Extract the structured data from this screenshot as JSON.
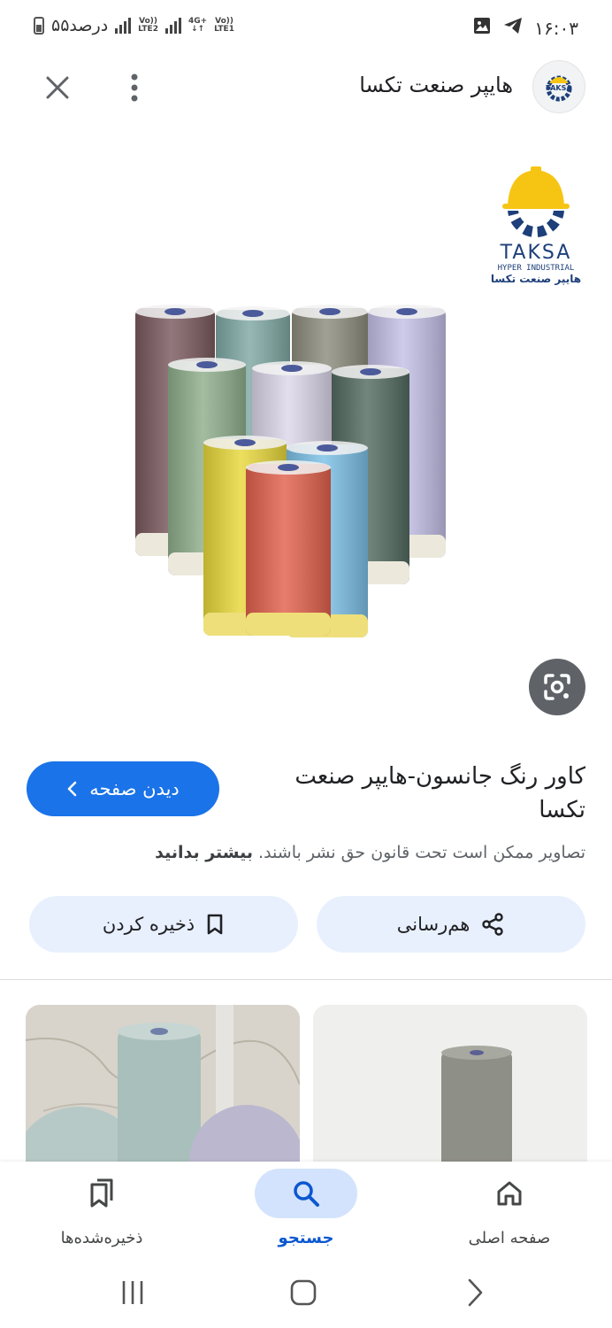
{
  "status_bar": {
    "battery_text": "۵۵درصد",
    "net1": [
      "Vo))",
      "LTE2"
    ],
    "net2": [
      "4G+",
      "↓↑"
    ],
    "net3": [
      "Vo))",
      "LTE1"
    ],
    "time": "۱۶:۰۳"
  },
  "header": {
    "site_name": "هایپر صنعت تکسا",
    "favicon_text": "TAKSA"
  },
  "image": {
    "logo_name": "TAKSA",
    "logo_subtitle": "HYPER INDUSTRIAL",
    "logo_persian": "هایپر صنعت تکسا",
    "roll_colors": {
      "brown": "#7a5a5e",
      "teal": "#7fa8a3",
      "olive": "#8c8d7d",
      "lavender": "#c3bfe6",
      "sage": "#8fae8c",
      "lilac": "#dcd7ea",
      "dark_green": "#536b60",
      "yellow": "#e8d83b",
      "sky": "#7cc0e6",
      "orange": "#e2614c"
    }
  },
  "result": {
    "title": "کاور رنگ جانسون-هایپر صنعت تکسا",
    "visit_label": "دیدن صفحه",
    "copyright_text": "تصاویر ممکن است تحت قانون حق نشر باشند.",
    "learn_more": "بیشتر بدانید",
    "share_label": "هم‌رسانی",
    "save_label": "ذخیره کردن"
  },
  "bottom_nav": {
    "items": [
      {
        "label": "صفحه اصلی",
        "icon": "home-icon"
      },
      {
        "label": "جستجو",
        "icon": "search-icon"
      },
      {
        "label": "ذخیره‌شده‌ها",
        "icon": "saved-icon"
      }
    ]
  },
  "colors": {
    "accent": "#1a73e8",
    "chip_bg": "#e8f0fe",
    "nav_active_bg": "#d3e3fd",
    "logo_yellow": "#f6c514",
    "logo_blue": "#1d3f7a"
  }
}
